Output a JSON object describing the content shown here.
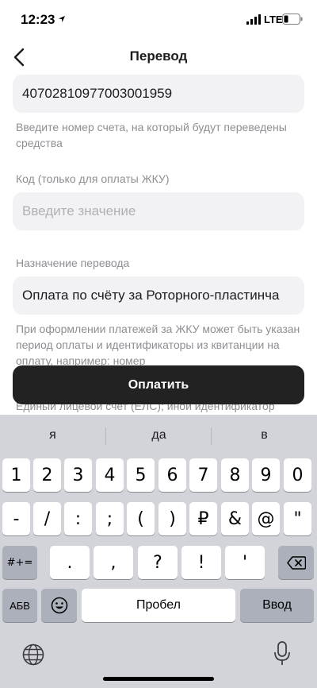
{
  "status_bar": {
    "time": "12:23",
    "network": "LTE"
  },
  "nav": {
    "title": "Перевод"
  },
  "form": {
    "account_value": "40702810977003001959",
    "account_hint": "Введите номер счета, на который будут переведены средства",
    "code_label": "Код (только для оплаты ЖКУ)",
    "code_placeholder": "Введите значение",
    "purpose_label": "Назначение перевода",
    "purpose_value": "Оплата по счёту за Роторного-пластинча",
    "purpose_hint": "При оформлении платежей за ЖКУ может быть указан период оплаты и идентификаторы из квитанции на оплату, например: номер",
    "purpose_hint_behind": "Единый лицевой счет (ЕЛС); иной идентификатор"
  },
  "pay_button": {
    "label": "Оплатить"
  },
  "keyboard": {
    "suggestions": [
      "я",
      "да",
      "в"
    ],
    "row1": [
      "1",
      "2",
      "3",
      "4",
      "5",
      "6",
      "7",
      "8",
      "9",
      "0"
    ],
    "row2": [
      "-",
      "/",
      ":",
      ";",
      "(",
      ")",
      "₽",
      "&",
      "@",
      "\""
    ],
    "row3_switch": "#+=",
    "row3": [
      ".",
      ",",
      "?",
      "!",
      "'"
    ],
    "row4_layout": "АБВ",
    "space_label": "Пробел",
    "enter_label": "Ввод"
  },
  "icons": {
    "back": "chevron-left-icon",
    "emoji": "emoji-icon",
    "globe": "globe-icon",
    "mic": "microphone-icon",
    "backspace": "backspace-icon",
    "location": "location-arrow-icon",
    "signal": "signal-bars-icon",
    "battery": "battery-icon"
  },
  "colors": {
    "button_bg": "#222222",
    "field_bg": "#f2f2f4",
    "hint_text": "#8e8e93",
    "keyboard_bg": "#d2d4da"
  }
}
